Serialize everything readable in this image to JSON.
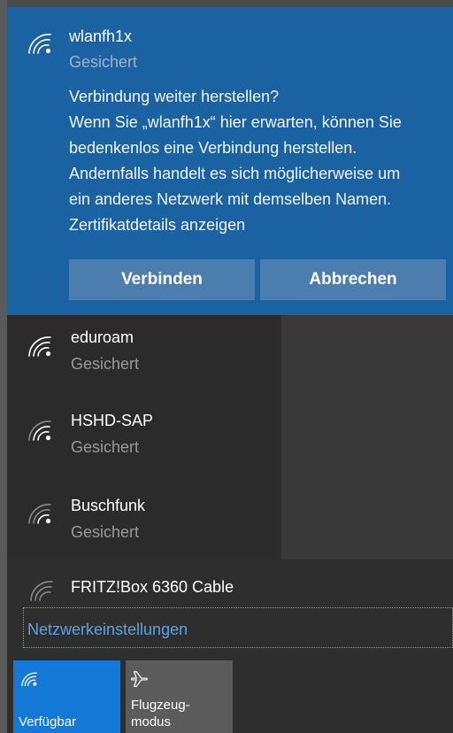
{
  "selected_network": {
    "name": "wlanfh1x",
    "status": "Gesichert",
    "prompt_lines": [
      "Verbindung weiter herstellen?",
      "Wenn Sie „wlanfh1x“ hier erwarten, können Sie",
      "bedenkenlos eine Verbindung herstellen.",
      "Andernfalls handelt es sich möglicherweise um",
      "ein anderes Netzwerk mit demselben Namen.",
      "Zertifikatdetails anzeigen"
    ],
    "connect_label": "Verbinden",
    "cancel_label": "Abbrechen",
    "icon": "wifi-icon"
  },
  "networks": [
    {
      "name": "eduroam",
      "status": "Gesichert",
      "icon": "wifi-icon"
    },
    {
      "name": "HSHD-SAP",
      "status": "Gesichert",
      "icon": "wifi-icon"
    },
    {
      "name": "Buschfunk",
      "status": "Gesichert",
      "icon": "wifi-icon"
    },
    {
      "name": "FRITZ!Box 6360 Cable",
      "icon": "wifi-icon"
    }
  ],
  "settings_link": "Netzwerkeinstellungen",
  "quick_actions": {
    "wifi": {
      "label": "Verfügbar",
      "icon": "wifi-icon"
    },
    "airplane": {
      "label_line1": "Flugzeug-",
      "label_line2": "modus",
      "icon": "airplane-icon"
    }
  },
  "colors": {
    "accent": "#1a62a2",
    "button": "#4b7eaf",
    "wifi_tile": "#1479d6",
    "airplane_tile": "#5b5b5b",
    "link": "#5aa3e6"
  }
}
